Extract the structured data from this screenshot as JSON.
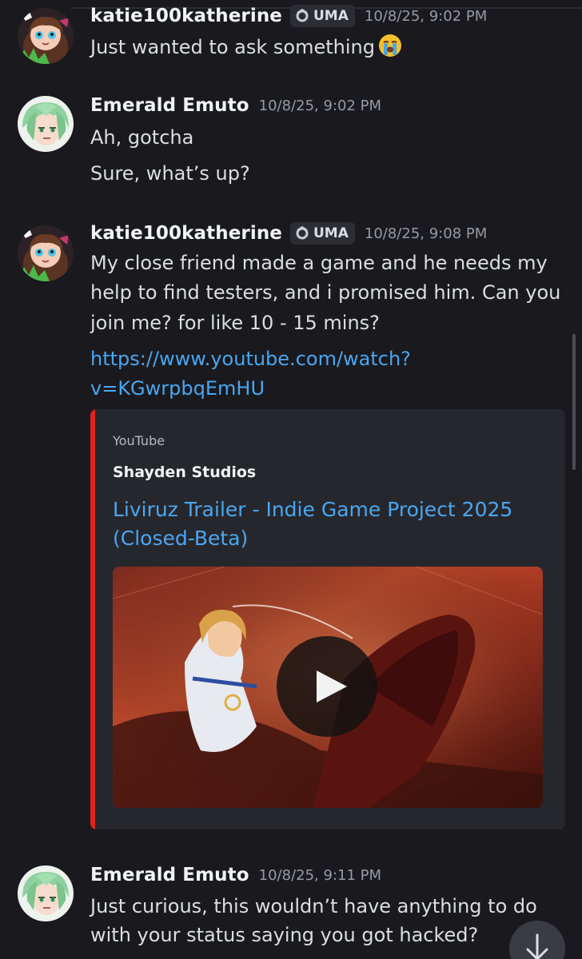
{
  "messages": [
    {
      "author": "katie100katherine",
      "tag": "UMA",
      "timestamp": "10/8/25, 9:02 PM",
      "lines": [
        "Just wanted to ask something"
      ],
      "emoji": "loudly-crying-face"
    },
    {
      "author": "Emerald Emuto",
      "timestamp": "10/8/25, 9:02 PM",
      "lines": [
        "Ah, gotcha",
        "Sure, what’s up?"
      ]
    },
    {
      "author": "katie100katherine",
      "tag": "UMA",
      "timestamp": "10/8/25, 9:08 PM",
      "lines": [
        "My close friend made a game and he needs my",
        "help to find testers, and i promised him. Can you",
        "join me? for like 10 - 15 mins?"
      ],
      "link_lines": [
        "https://www.youtube.com/watch?",
        "v=KGwrpbqEmHU"
      ],
      "embed": {
        "provider": "YouTube",
        "author": "Shayden Studios",
        "title_lines": [
          "Liviruz Trailer - Indie Game Project 2025",
          "(Closed-Beta)"
        ],
        "accent_color": "#e3231b"
      }
    },
    {
      "author": "Emerald Emuto",
      "timestamp": "10/8/25, 9:11 PM",
      "lines": [
        "Just curious, this wouldn’t have anything to do",
        "with your status saying you got hacked?"
      ]
    }
  ],
  "icons": {
    "tag": "uma-tag-icon",
    "play": "play-icon",
    "jump": "arrow-down-icon"
  },
  "colors": {
    "background": "#1a1a1e",
    "link": "#4aa6f0",
    "embed_bar": "#e3231b"
  }
}
